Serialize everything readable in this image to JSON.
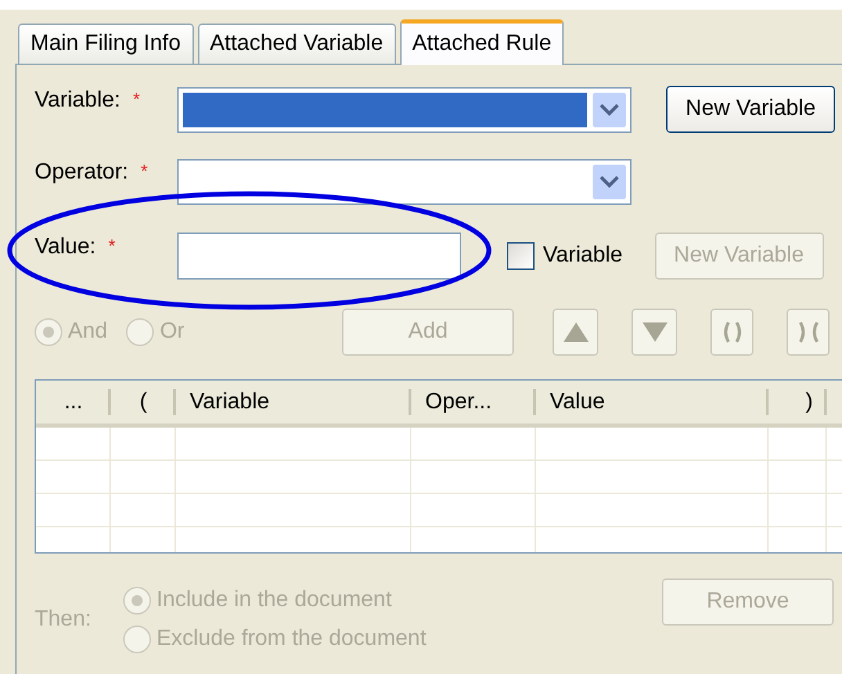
{
  "tabs": [
    {
      "label": "Main Filing Info",
      "selected": false
    },
    {
      "label": "Attached Variable",
      "selected": false
    },
    {
      "label": "Attached Rule",
      "selected": true
    }
  ],
  "variable": {
    "label": "Variable:",
    "required_mark": "*",
    "highlighted": true,
    "button": {
      "label": "New Variable",
      "disabled": false
    }
  },
  "operator": {
    "label": "Operator:",
    "required_mark": "*",
    "highlighted": false
  },
  "value": {
    "label": "Value:",
    "required_mark": "*",
    "circled": true,
    "checkbox": {
      "label": "Variable",
      "checked": false
    },
    "button": {
      "label": "New Variable",
      "disabled": true
    }
  },
  "join": {
    "options": [
      {
        "label": "And",
        "selected": true,
        "disabled": true
      },
      {
        "label": "Or",
        "selected": false,
        "disabled": true
      }
    ],
    "add": {
      "label": "Add",
      "disabled": true
    },
    "tools": [
      {
        "kind": "up",
        "disabled": true
      },
      {
        "kind": "down",
        "disabled": true
      },
      {
        "kind": "group",
        "disabled": true
      },
      {
        "kind": "split",
        "disabled": true
      }
    ]
  },
  "table": {
    "columns": [
      "...",
      "(",
      "Variable",
      "Oper...",
      "Value",
      ")"
    ]
  },
  "then": {
    "label": "Then:",
    "disabled": true,
    "options": [
      {
        "label": "Include in the document",
        "selected": true,
        "disabled": true
      },
      {
        "label": "Exclude from the document",
        "selected": false,
        "disabled": true
      }
    ],
    "remove": {
      "label": "Remove",
      "disabled": true
    }
  }
}
